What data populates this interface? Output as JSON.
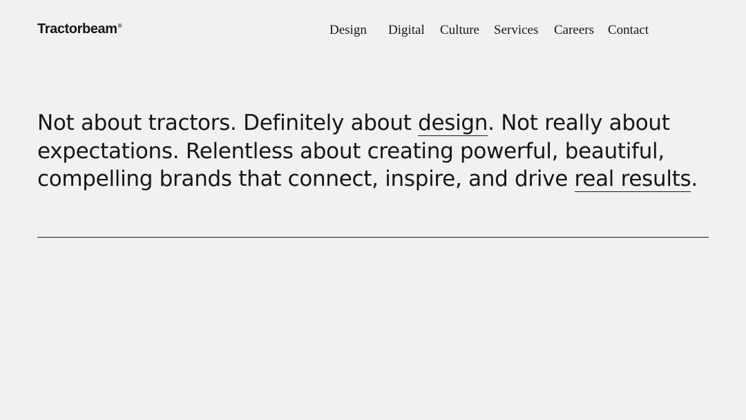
{
  "header": {
    "logo_text": "Tractorbeam",
    "logo_mark": "®",
    "nav": [
      {
        "label": "Design"
      },
      {
        "label": "Digital"
      },
      {
        "label": "Culture"
      },
      {
        "label": "Services"
      },
      {
        "label": "Careers"
      },
      {
        "label": "Contact"
      }
    ]
  },
  "hero": {
    "line1_a": "Not about tractors. Definitely about ",
    "link_design": "design",
    "line1_b": ". Not really about",
    "line2": "expectations. Relentless about creating powerful, beautiful,",
    "line3_a": "compelling brands that connect, inspire, and drive ",
    "link_results": "real results",
    "line3_b": "."
  }
}
